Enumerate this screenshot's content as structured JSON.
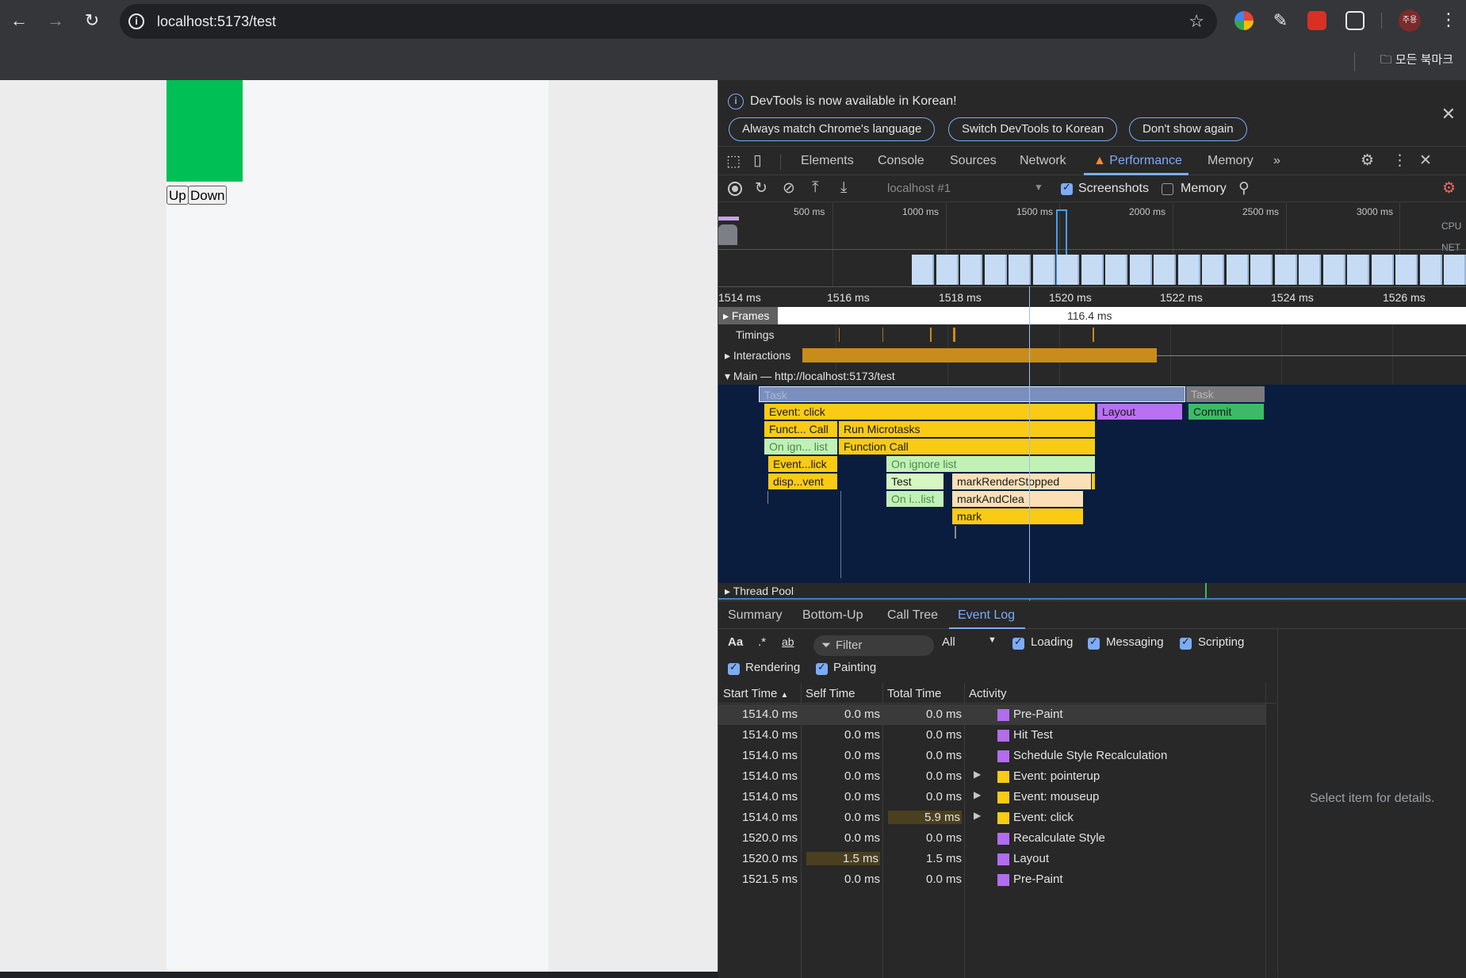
{
  "browser": {
    "url": "localhost:5173/test",
    "bookmarks_folder": "모든 북마크",
    "profile_initials": "주용"
  },
  "page": {
    "buttons": {
      "up": "Up",
      "down": "Down"
    },
    "box_color": "#00c055"
  },
  "devtools": {
    "infobar": {
      "message": "DevTools is now available in Korean!",
      "btn_match": "Always match Chrome's language",
      "btn_switch": "Switch DevTools to Korean",
      "btn_dont_show": "Don't show again"
    },
    "tabs": [
      "Elements",
      "Console",
      "Sources",
      "Network",
      "Performance",
      "Memory"
    ],
    "active_tab": "Performance",
    "perf_toolbar": {
      "target": "localhost #1",
      "screenshots_label": "Screenshots",
      "memory_label": "Memory"
    },
    "overview_ticks": [
      "500 ms",
      "1000 ms",
      "1500 ms",
      "2000 ms",
      "2500 ms",
      "3000 ms"
    ],
    "overview_labels": {
      "cpu": "CPU",
      "net": "NET"
    },
    "ruler_ticks": [
      "1514 ms",
      "1516 ms",
      "1518 ms",
      "1520 ms",
      "1522 ms",
      "1524 ms",
      "1526 ms"
    ],
    "tracks": {
      "frames": "Frames",
      "frame_duration": "116.4 ms",
      "timings": "Timings",
      "interactions": "Interactions",
      "main": "Main — http://localhost:5173/test",
      "thread_pool": "Thread Pool"
    },
    "flame": {
      "task1": "Task",
      "task2": "Task",
      "event_click": "Event: click",
      "layout": "Layout",
      "commit": "Commit",
      "funct_call": "Funct... Call",
      "run_microtasks": "Run Microtasks",
      "on_ign_list": "On ign... list",
      "function_call": "Function Call",
      "event_lick": "Event...lick",
      "on_ignore_list": "On ignore list",
      "disp_vent": "disp...vent",
      "test": "Test",
      "mark_render_stopped": "markRenderStopped",
      "on_i_list": "On i...list",
      "mark_and_clear": "markAndClea",
      "mark": "mark"
    },
    "bottom_tabs": [
      "Summary",
      "Bottom-Up",
      "Call Tree",
      "Event Log"
    ],
    "active_bottom_tab": "Event Log",
    "filters": {
      "aa": "Aa",
      "placeholder": "Filter",
      "level": "All",
      "loading": "Loading",
      "messaging": "Messaging",
      "scripting": "Scripting",
      "rendering": "Rendering",
      "painting": "Painting"
    },
    "table": {
      "headers": {
        "start": "Start Time",
        "self": "Self Time",
        "total": "Total Time",
        "activity": "Activity"
      },
      "rows": [
        {
          "start": "1514.0 ms",
          "self": "0.0 ms",
          "total": "0.0 ms",
          "activity": "Pre-Paint",
          "color": "#b26cf0",
          "expand": false
        },
        {
          "start": "1514.0 ms",
          "self": "0.0 ms",
          "total": "0.0 ms",
          "activity": "Hit Test",
          "color": "#b26cf0",
          "expand": false
        },
        {
          "start": "1514.0 ms",
          "self": "0.0 ms",
          "total": "0.0 ms",
          "activity": "Schedule Style Recalculation",
          "color": "#b26cf0",
          "expand": false
        },
        {
          "start": "1514.0 ms",
          "self": "0.0 ms",
          "total": "0.0 ms",
          "activity": "Event: pointerup",
          "color": "#f9cb14",
          "expand": true
        },
        {
          "start": "1514.0 ms",
          "self": "0.0 ms",
          "total": "0.0 ms",
          "activity": "Event: mouseup",
          "color": "#f9cb14",
          "expand": true
        },
        {
          "start": "1514.0 ms",
          "self": "0.0 ms",
          "total": "5.9 ms",
          "activity": "Event: click",
          "color": "#f9cb14",
          "expand": true
        },
        {
          "start": "1520.0 ms",
          "self": "0.0 ms",
          "total": "0.0 ms",
          "activity": "Recalculate Style",
          "color": "#b26cf0",
          "expand": false
        },
        {
          "start": "1520.0 ms",
          "self": "1.5 ms",
          "total": "1.5 ms",
          "activity": "Layout",
          "color": "#b26cf0",
          "expand": false
        },
        {
          "start": "1521.5 ms",
          "self": "0.0 ms",
          "total": "0.0 ms",
          "activity": "Pre-Paint",
          "color": "#b26cf0",
          "expand": false
        }
      ]
    },
    "details_placeholder": "Select item for details."
  }
}
